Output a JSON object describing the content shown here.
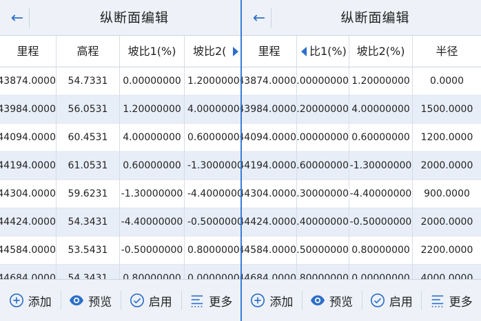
{
  "title": "纵断面编辑",
  "back_glyph": "←",
  "headers": {
    "mileage": "里程",
    "elevation": "高程",
    "slope1": "坡比1(%)",
    "slope1_clipped": "比1(%)",
    "slope2": "坡比2(%)",
    "slope2_clipped": "坡比2(",
    "radius": "半径"
  },
  "rows": [
    {
      "mileage": "43874.0000",
      "elevation": "54.7331",
      "slope1": "0.00000000",
      "slope2": "1.20000000",
      "radius": "0.0000"
    },
    {
      "mileage": "43984.0000",
      "elevation": "56.0531",
      "slope1": "1.20000000",
      "slope2": "4.00000000",
      "radius": "1500.0000"
    },
    {
      "mileage": "44094.0000",
      "elevation": "60.4531",
      "slope1": "4.00000000",
      "slope2": "0.60000000",
      "radius": "1200.0000"
    },
    {
      "mileage": "44194.0000",
      "elevation": "61.0531",
      "slope1": "0.60000000",
      "slope2": "-1.30000000",
      "radius": "2000.0000"
    },
    {
      "mileage": "44304.0000",
      "elevation": "59.6231",
      "slope1": "-1.30000000",
      "slope2": "-4.40000000",
      "radius": "900.0000"
    },
    {
      "mileage": "44424.0000",
      "elevation": "54.3431",
      "slope1": "-4.40000000",
      "slope2": "-0.50000000",
      "radius": "2000.0000"
    },
    {
      "mileage": "44584.0000",
      "elevation": "53.5431",
      "slope1": "-0.50000000",
      "slope2": "0.80000000",
      "radius": "2200.0000"
    },
    {
      "mileage": "44684.0000",
      "elevation": "54.3431",
      "slope1": "0.80000000",
      "slope2": "0.00000000",
      "radius": "4000.0000"
    }
  ],
  "toolbar": {
    "add": "添加",
    "preview": "预览",
    "enable": "启用",
    "more": "更多"
  },
  "colors": {
    "accent": "#2d6fc9",
    "bar_bg": "#eef2f8",
    "row_alt": "#e8eef8",
    "divider": "#3a7bd5"
  },
  "icons": {
    "back": "arrow-left-icon",
    "add": "plus-circle-icon",
    "preview": "eye-icon",
    "enable": "check-circle-icon",
    "more": "menu-lines-icon",
    "scroll_right": "triangle-right-icon",
    "scroll_left": "triangle-left-icon"
  }
}
